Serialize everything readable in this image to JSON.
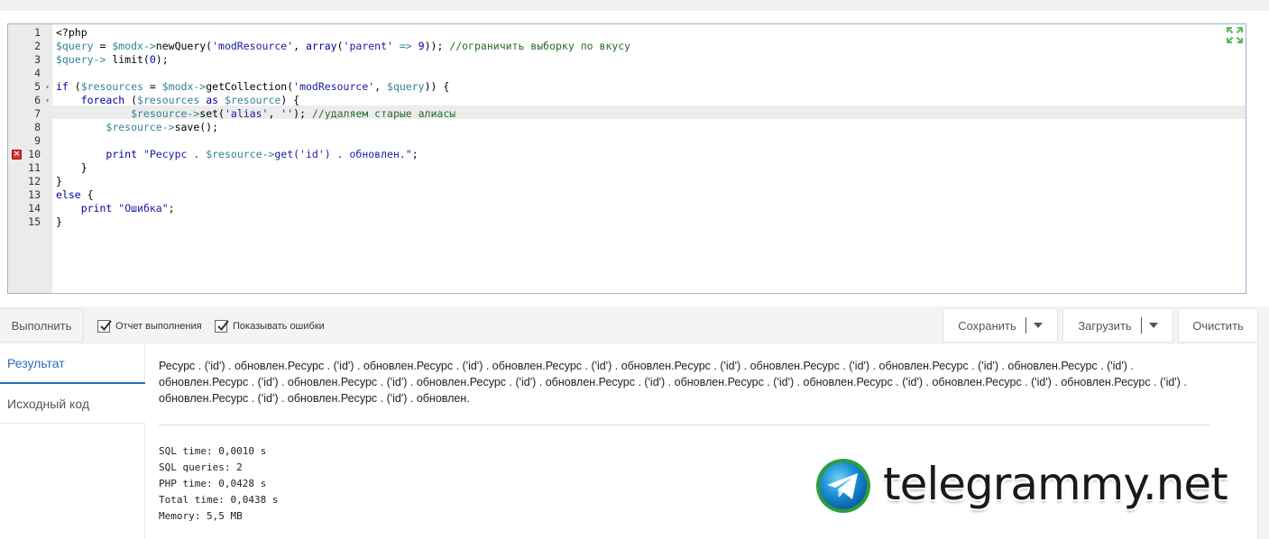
{
  "editor": {
    "lines": [
      {
        "num": "1",
        "fold": false,
        "error": false,
        "indent": "",
        "tokens": [
          [
            "plain",
            "<?php"
          ]
        ]
      },
      {
        "num": "2",
        "fold": false,
        "error": false,
        "indent": "",
        "tokens": [
          [
            "var",
            "$query"
          ],
          [
            "plain",
            " = "
          ],
          [
            "var",
            "$modx->"
          ],
          [
            "plain",
            "newQuery("
          ],
          [
            "str",
            "'modResource'"
          ],
          [
            "plain",
            ", "
          ],
          [
            "kw",
            "array"
          ],
          [
            "plain",
            "("
          ],
          [
            "str",
            "'parent'"
          ],
          [
            "plain",
            " "
          ],
          [
            "var",
            "=>"
          ],
          [
            "plain",
            " "
          ],
          [
            "num",
            "9"
          ],
          [
            "plain",
            ")); "
          ],
          [
            "cmt",
            "//ограничить выборку по вкусу"
          ]
        ]
      },
      {
        "num": "3",
        "fold": false,
        "error": false,
        "indent": "",
        "tokens": [
          [
            "var",
            "$query->"
          ],
          [
            "plain",
            " limit("
          ],
          [
            "num",
            "0"
          ],
          [
            "plain",
            ");"
          ]
        ]
      },
      {
        "num": "4",
        "fold": false,
        "error": false,
        "indent": "",
        "tokens": []
      },
      {
        "num": "5",
        "fold": true,
        "error": false,
        "indent": "",
        "tokens": [
          [
            "kw",
            "if"
          ],
          [
            "plain",
            " ("
          ],
          [
            "var",
            "$resources"
          ],
          [
            "plain",
            " = "
          ],
          [
            "var",
            "$modx->"
          ],
          [
            "plain",
            "getCollection("
          ],
          [
            "str",
            "'modResource'"
          ],
          [
            "plain",
            ", "
          ],
          [
            "var",
            "$query"
          ],
          [
            "plain",
            ")) {"
          ]
        ]
      },
      {
        "num": "6",
        "fold": true,
        "error": false,
        "indent": "    ",
        "tokens": [
          [
            "kw",
            "foreach"
          ],
          [
            "plain",
            " ("
          ],
          [
            "var",
            "$resources"
          ],
          [
            "plain",
            " "
          ],
          [
            "kw",
            "as"
          ],
          [
            "plain",
            " "
          ],
          [
            "var",
            "$resource"
          ],
          [
            "plain",
            ") {"
          ]
        ]
      },
      {
        "num": "7",
        "fold": false,
        "error": false,
        "indent": "            ",
        "tokens": [
          [
            "var",
            "$resource->"
          ],
          [
            "plain",
            "set("
          ],
          [
            "str",
            "'alias'"
          ],
          [
            "plain",
            ", "
          ],
          [
            "str",
            "''"
          ],
          [
            "plain",
            "); "
          ],
          [
            "cmt",
            "//удаляем старые алиасы"
          ]
        ]
      },
      {
        "num": "8",
        "fold": false,
        "error": false,
        "indent": "        ",
        "tokens": [
          [
            "var",
            "$resource->"
          ],
          [
            "plain",
            "save();"
          ]
        ]
      },
      {
        "num": "9",
        "fold": false,
        "error": false,
        "indent": "",
        "tokens": []
      },
      {
        "num": "10",
        "fold": false,
        "error": true,
        "indent": "        ",
        "tokens": [
          [
            "kw",
            "print"
          ],
          [
            "plain",
            " "
          ],
          [
            "str",
            "\"Ресурс . "
          ],
          [
            "var",
            "$resource->"
          ],
          [
            "str",
            "get("
          ],
          [
            "str",
            "'id'"
          ],
          [
            "str",
            ") . обновлен.\""
          ],
          [
            "plain",
            ";"
          ]
        ]
      },
      {
        "num": "11",
        "fold": false,
        "error": false,
        "indent": "    ",
        "tokens": [
          [
            "plain",
            "}"
          ]
        ]
      },
      {
        "num": "12",
        "fold": false,
        "error": false,
        "indent": "",
        "tokens": [
          [
            "plain",
            "}"
          ]
        ]
      },
      {
        "num": "13",
        "fold": false,
        "error": false,
        "indent": "",
        "tokens": [
          [
            "kw",
            "else"
          ],
          [
            "plain",
            " {"
          ]
        ]
      },
      {
        "num": "14",
        "fold": false,
        "error": false,
        "indent": "    ",
        "tokens": [
          [
            "kw",
            "print"
          ],
          [
            "plain",
            " "
          ],
          [
            "str",
            "\"Ошибка\""
          ],
          [
            "plain",
            ";"
          ]
        ]
      },
      {
        "num": "15",
        "fold": false,
        "error": false,
        "indent": "",
        "tokens": [
          [
            "plain",
            "}"
          ]
        ]
      }
    ],
    "expand_icon": "expand-arrows-icon",
    "colors": {
      "keyword": "#0000a2",
      "variable": "#318495",
      "string": "#1a1aa6",
      "comment": "#236e24",
      "number": "#0000cd"
    }
  },
  "toolbar": {
    "run_label": "Выполнить",
    "report_label": "Отчет выполнения",
    "show_errors_label": "Показывать ошибки",
    "save_label": "Сохранить",
    "load_label": "Загрузить",
    "clear_label": "Очистить"
  },
  "tabs": {
    "result": "Результат",
    "source": "Исходный код"
  },
  "result": {
    "text": "Ресурс . ('id') . обновлен.Ресурс . ('id') . обновлен.Ресурс . ('id') . обновлен.Ресурс . ('id') . обновлен.Ресурс . ('id') . обновлен.Ресурс . ('id') . обновлен.Ресурс . ('id') . обновлен.Ресурс . ('id') . обновлен.Ресурс . ('id') . обновлен.Ресурс . ('id') . обновлен.Ресурс . ('id') . обновлен.Ресурс . ('id') . обновлен.Ресурс . ('id') . обновлен.Ресурс . ('id') . обновлен.Ресурс . ('id') . обновлен.Ресурс . ('id') . обновлен.Ресурс . ('id') . обновлен.Ресурс . ('id') . обновлен."
  },
  "stats": {
    "sql_time": "SQL time: 0,0010 s",
    "sql_queries": "SQL queries: 2",
    "php_time": "PHP time: 0,0428 s",
    "total_time": "Total time: 0,0438 s",
    "memory": "Memory: 5,5 MB"
  },
  "watermark": {
    "text": "telegrammy.net",
    "icon": "telegram-logo-icon"
  }
}
